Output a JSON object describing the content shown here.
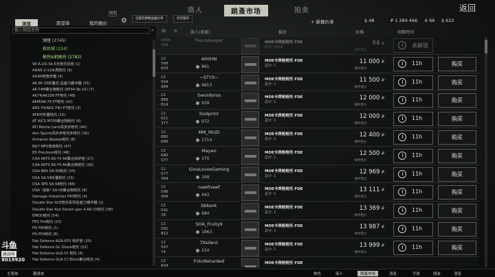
{
  "topnav": {
    "tabs": [
      "商人",
      "跳蚤市场",
      "拍卖"
    ],
    "active_tab": "跳蚤市场",
    "back_label": "返回"
  },
  "subnav": {
    "tabs": [
      "浏览",
      "愿望单",
      "我的报价"
    ],
    "offers_count": "0/3",
    "pills": [
      "全部交换物品报价单",
      "仅可操作"
    ],
    "new_offer_label": "新报价单",
    "currencies": [
      "$ 48",
      "₽ 1 284 466",
      "€ 66",
      "$ 622"
    ]
  },
  "search": {
    "placeholder": "输入物品名称"
  },
  "categories": [
    {
      "label": "弹匣 (2745)",
      "style": "normal"
    },
    {
      "label": "枚机械 (224)",
      "style": "green"
    },
    {
      "label": "枪托&机枪托 (2782)",
      "style": "sel"
    }
  ],
  "items": [
    "SE-A-23i Sb.5无枪托机枪 (1)",
    "ADAR 2-15木质枪托 (6)",
    "ADAR枪管护套 (4)",
    "AK 6P-20折叠式 后座力缓冲器 (35)",
    "AK-74M聚合物枪托 (6P34 Sb.15) (7)",
    "AK74/AK100 PT枪托 (48)",
    "AKM/AK-74 PT枪托 (42)",
    "AKS-74/AKS-74U PT枪托 (2)",
    "AFB可折叠枪托 (15)",
    "AT AICS M700聚合物枪托 (8)",
    "ATI Monte Carlo风步步枪托 (44)",
    "Aim Sports风步步枪托步枪托 (16)",
    "Armacon Baskak枪托 (8)",
    "B&T MP5管道枪托 (47)",
    "B5 Precision枪托 (48)",
    "CAA AKTS AK-74 AK聚合体护管 (17)",
    "CAA AKTS AK-74 AK聚合物枪托 (26)",
    "DSA BRS SA-58枪托 (33)",
    "DSA SA-58折叠枪托 (15)",
    "DSA SPR SA-58枪托 (48)",
    "DSA \"战争\" SA-58聚合物枪托 (8)",
    "Damage Industries P90枪托 (4)",
    "Double Star ACE枪托系列后座力缓冲器 (2)",
    "Double Star Ace Socom gen.4 AR-15枪托 (38)",
    "EMOD枪托 (54)",
    "FB3 Pro枪托 (22)",
    "FN P90枪托 (1)",
    "FN P59枪托 (8)",
    "Fab Defence AGR-870 枪护管 (30)",
    "Fab Defence GL Shock枪托 (52)",
    "Fab Defence GLR-15 枪托 (4)",
    "Fab Defence GLR-17 Block聚合枪托 (4)"
  ],
  "table_header": {
    "id": "ID",
    "seller": "商人(卖家)",
    "offer": "报价",
    "price": "价格",
    "expires": "到期时间"
  },
  "offers": [
    {
      "id": "9996\n488",
      "seller": "Peacekeeper",
      "rating": "",
      "item": "MOE卡宾枪枪托 FDE",
      "qty": "总计: 3929",
      "price": "64",
      "currency": "$",
      "price_label": "每件售价",
      "time": "未解锁",
      "buy": "",
      "faded": true
    },
    {
      "id": "12\n598\n603",
      "seller": "A00HN",
      "rating": "861",
      "item": "MOE卡宾枪枪托 FDE",
      "qty": "总计: 1",
      "price": "11 000",
      "currency": "₽",
      "price_label": "每件售价",
      "time": "11h",
      "buy": "购买",
      "faded": false
    },
    {
      "id": "12\n594\n989",
      "seller": "~STYX~",
      "rating": "4813",
      "item": "MOE卡宾枪枪托 FDE",
      "qty": "总计: 1",
      "price": "11 500",
      "currency": "₽",
      "price_label": "每件售价",
      "time": "11h",
      "buy": "购买",
      "faded": false
    },
    {
      "id": "12\n889\n814",
      "seller": "Swordoros",
      "rating": "928",
      "item": "MOE卡宾枪枪托 FDE",
      "qty": "总计: 1",
      "price": "12 000",
      "currency": "₽",
      "price_label": "每件售价",
      "time": "11h",
      "buy": "购买",
      "faded": false
    },
    {
      "id": "12\n611\n377",
      "seller": "footprint",
      "rating": "972",
      "item": "MOE卡宾枪枪托 FDE",
      "qty": "总计: 1",
      "price": "12 000",
      "currency": "₽",
      "price_label": "每件售价",
      "time": "11h",
      "buy": "购买",
      "faded": false
    },
    {
      "id": "12\n680\n688",
      "seller": "MM_MUZI",
      "rating": "1714",
      "item": "MOE卡宾枪枪托 FDE",
      "qty": "总计: 1",
      "price": "12 400",
      "currency": "₽",
      "price_label": "每件售价",
      "time": "11h",
      "buy": "购买",
      "faded": false
    },
    {
      "id": "12\n690\n577",
      "seller": "Mayan",
      "rating": "370",
      "item": "MOE卡宾枪枪托 FDE",
      "qty": "总计: 1",
      "price": "12 500",
      "currency": "₽",
      "price_label": "每件售价",
      "time": "11h",
      "buy": "购买",
      "faded": false
    },
    {
      "id": "12\n577\n394",
      "seller": "GinaLovesGaming",
      "rating": "168",
      "item": "MOE卡宾枪枪托 FDE",
      "qty": "总计: 1",
      "price": "12 969",
      "currency": "₽",
      "price_label": "每件售价",
      "time": "11h",
      "buy": "购买",
      "faded": false
    },
    {
      "id": "12\n596\n409",
      "seller": "nawfnawf",
      "rating": "443",
      "item": "MOE卡宾枪枪托 FDE",
      "qty": "总计: 1",
      "price": "13 111",
      "currency": "₽",
      "price_label": "每件售价",
      "time": "11h",
      "buy": "购买",
      "faded": false
    },
    {
      "id": "12\n591\n18",
      "seller": "bbbork",
      "rating": "684",
      "item": "MOE卡宾枪枪托 FDE",
      "qty": "总计: 1",
      "price": "13 369",
      "currency": "₽",
      "price_label": "每件售价",
      "time": "11h",
      "buy": "购买",
      "faded": false
    },
    {
      "id": "12\n592\n812",
      "seller": "SOA_Fruity9",
      "rating": "1863",
      "item": "MOE卡宾枪枪托 FDE",
      "qty": "总计: 1",
      "price": "13 987",
      "currency": "₽",
      "price_label": "每件售价",
      "time": "11h",
      "buy": "购买",
      "faded": false
    },
    {
      "id": "12\n597\n74",
      "seller": "TKsilent",
      "rating": "224",
      "item": "MOE卡宾枪枪托 FDE",
      "qty": "总计: 1",
      "price": "13 999",
      "currency": "₽",
      "price_label": "每件售价",
      "time": "11h",
      "buy": "购买",
      "faded": false
    },
    {
      "id": "12\n604",
      "seller": "FcknRetarded",
      "rating": "",
      "item": "MOE卡宾枪枪托 FDE",
      "qty": "",
      "price": "",
      "currency": "",
      "price_label": "",
      "time": "",
      "buy": "",
      "faded": false
    }
  ],
  "watermark": {
    "brand": "斗鱼",
    "sub": "房间号",
    "room": "8019920"
  },
  "bottombar": {
    "left": [
      "主菜单",
      "藏身处"
    ],
    "right": [
      "角色",
      "商人",
      "跳蚤市场",
      "消息",
      "手册",
      "朋友",
      "消息"
    ],
    "active": "跳蚤市场"
  }
}
